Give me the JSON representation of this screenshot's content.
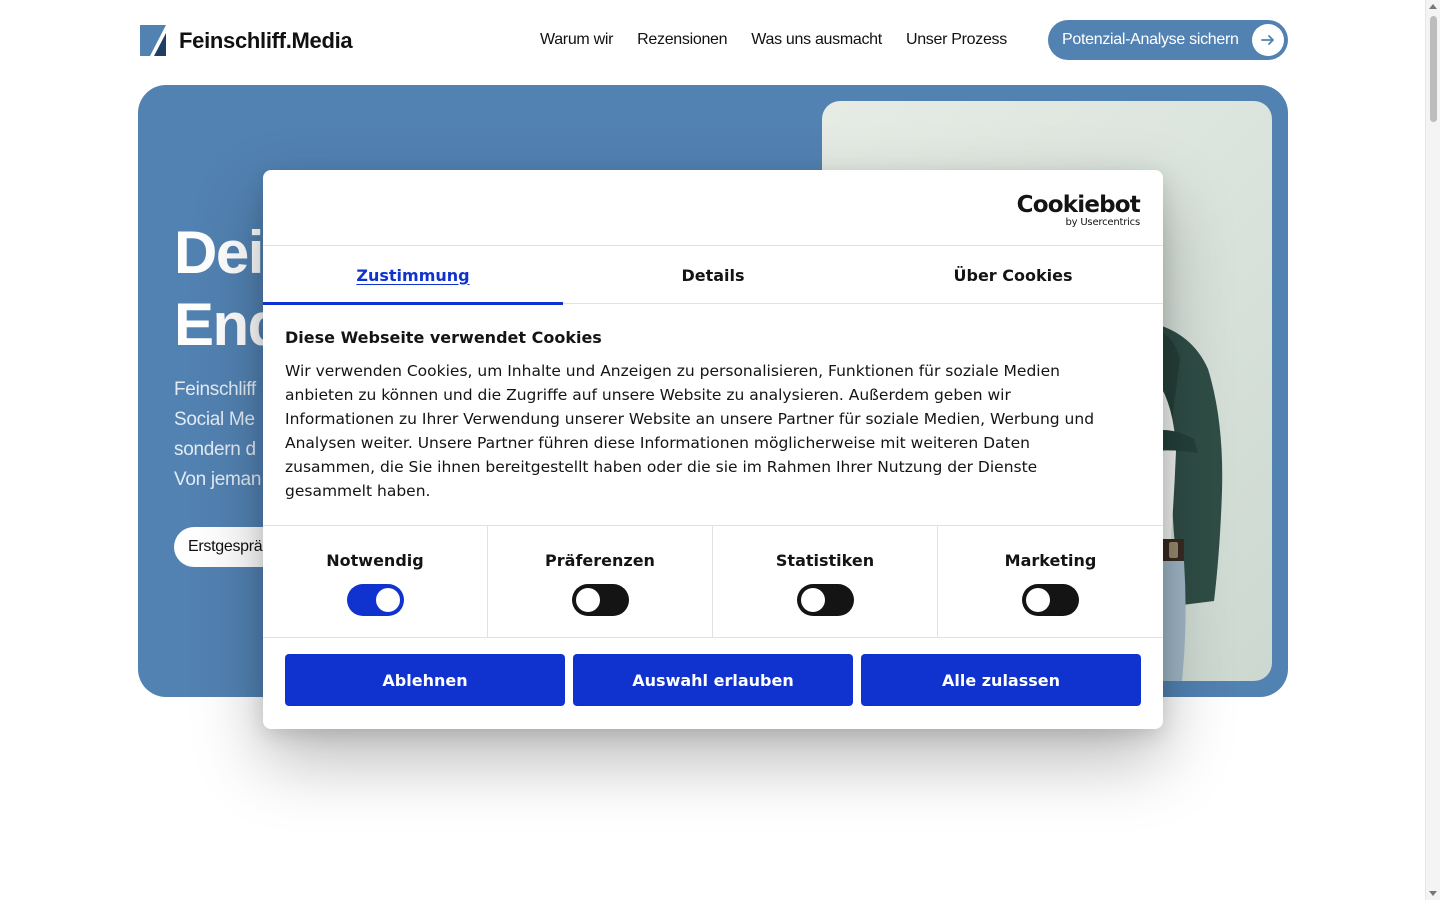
{
  "header": {
    "brand": "Feinschliff.Media",
    "nav": [
      "Warum wir",
      "Rezensionen",
      "Was uns ausmacht",
      "Unser Prozess"
    ],
    "cta_label": "Potenzial-Analyse sichern",
    "accent_color": "#5282b2"
  },
  "hero": {
    "title_lines": [
      "Dei",
      "End"
    ],
    "text_lines": [
      "Feinschliff",
      "Social Me",
      "sondern d",
      "Von jeman"
    ],
    "button_label": "Erstgesprä"
  },
  "cookie_dialog": {
    "logo_word": "Cookiebot",
    "logo_sub": "by Usercentrics",
    "tabs": [
      {
        "label": "Zustimmung",
        "active": true
      },
      {
        "label": "Details",
        "active": false
      },
      {
        "label": "Über Cookies",
        "active": false
      }
    ],
    "heading": "Diese Webseite verwendet Cookies",
    "body_lines": [
      "Wir verwenden Cookies, um Inhalte und Anzeigen zu personalisieren, Funktionen für soziale Medien",
      "anbieten zu können und die Zugriffe auf unsere Website zu analysieren. Außerdem geben wir",
      "Informationen zu Ihrer Verwendung unserer Website an unsere Partner für soziale Medien, Werbung und",
      "Analysen weiter. Unsere Partner führen diese Informationen möglicherweise mit weiteren Daten",
      "zusammen, die Sie ihnen bereitgestellt haben oder die sie im Rahmen Ihrer Nutzung der Dienste",
      "gesammelt haben."
    ],
    "categories": [
      {
        "label": "Notwendig",
        "enabled": true
      },
      {
        "label": "Präferenzen",
        "enabled": false
      },
      {
        "label": "Statistiken",
        "enabled": false
      },
      {
        "label": "Marketing",
        "enabled": false
      }
    ],
    "buttons": [
      "Ablehnen",
      "Auswahl erlauben",
      "Alle zulassen"
    ],
    "accent_color": "#1032cf"
  }
}
